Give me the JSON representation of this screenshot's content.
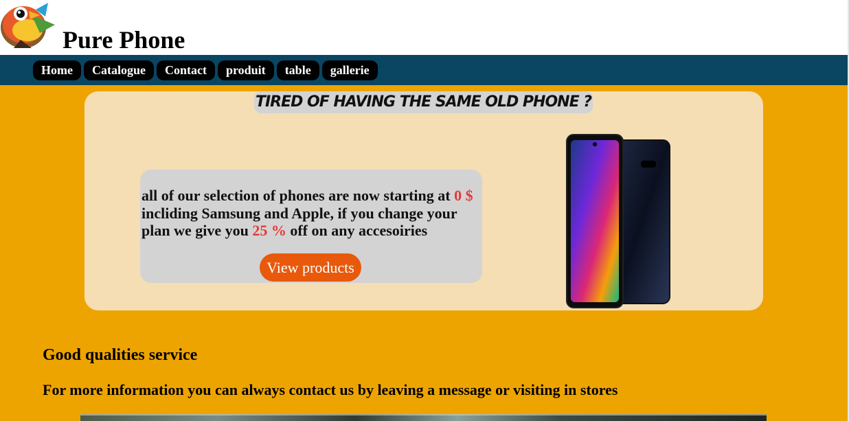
{
  "header": {
    "brand": "Pure Phone",
    "logo_icon": "bird-logo-icon"
  },
  "nav": {
    "items": [
      "Home",
      "Catalogue",
      "Contact",
      "produit",
      "table",
      "gallerie"
    ]
  },
  "hero": {
    "title": "TIRED OF HAVING THE SAME OLD PHONE ?",
    "promo": {
      "t1": "all of our selection of phones are now starting at ",
      "price": "0 $",
      "t2": " incliding Samsung and Apple, if you change your plan we give you ",
      "discount": "25 %",
      "t3": " off on any accesoiries"
    },
    "cta_label": "View products",
    "phone_image": "smartphone-image"
  },
  "section": {
    "title": "Good qualities service",
    "text": "For more information you can always contact us by leaving a message or visiting in stores"
  },
  "colors": {
    "navbar": "#0a4562",
    "main_bg": "#eea400",
    "hero_bg": "#f5deb3",
    "box_bg": "#d3d3d3",
    "cta": "#e8590c",
    "highlight": "#e53935"
  }
}
